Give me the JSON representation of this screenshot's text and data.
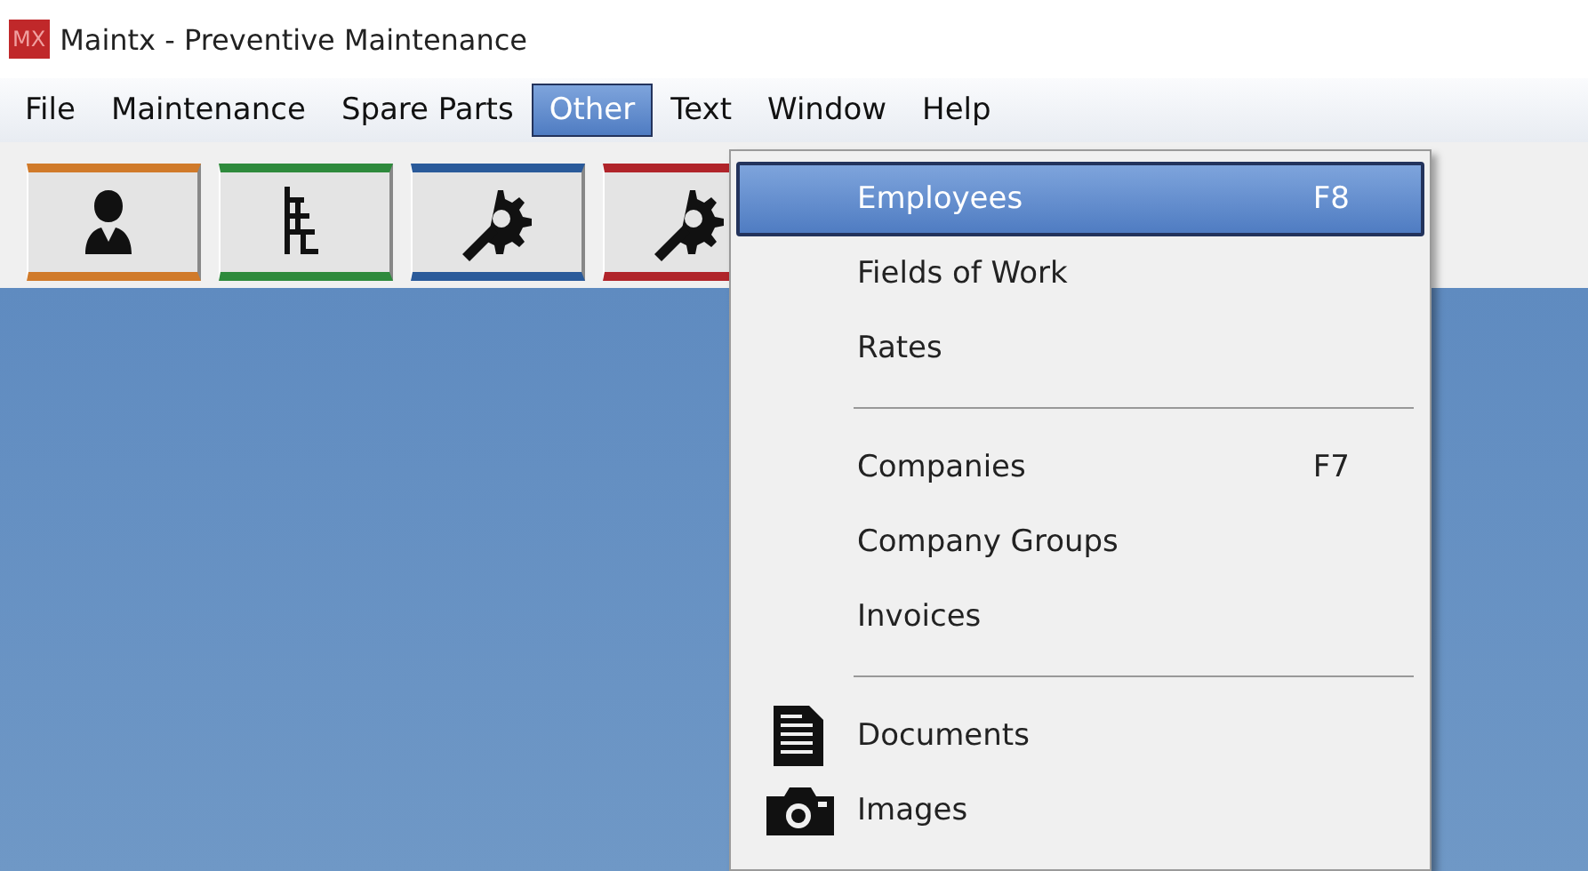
{
  "window": {
    "title": "Maintx - Preventive Maintenance",
    "logo": "MX"
  },
  "menubar": [
    {
      "label": "File",
      "selected": false
    },
    {
      "label": "Maintenance",
      "selected": false
    },
    {
      "label": "Spare Parts",
      "selected": false
    },
    {
      "label": "Other",
      "selected": true
    },
    {
      "label": "Text",
      "selected": false
    },
    {
      "label": "Window",
      "selected": false
    },
    {
      "label": "Help",
      "selected": false
    }
  ],
  "toolbar": [
    {
      "kind": "person",
      "color": "#d07a2a"
    },
    {
      "kind": "tree",
      "color": "#2e8a3c"
    },
    {
      "kind": "gear",
      "color": "#2a5a9a"
    },
    {
      "kind": "gear",
      "color": "#b0242a"
    }
  ],
  "menu": [
    {
      "kind": "plain",
      "label": "Employees",
      "shortcut": "F8",
      "selected": true
    },
    {
      "kind": "plain",
      "label": "Fields of Work",
      "selected": false
    },
    {
      "kind": "plain",
      "label": "Rates",
      "selected": false
    },
    {
      "kind": "separator"
    },
    {
      "kind": "plain",
      "label": "Companies",
      "shortcut": "F7",
      "selected": false
    },
    {
      "kind": "plain",
      "label": "Company Groups",
      "selected": false
    },
    {
      "kind": "plain",
      "label": "Invoices",
      "selected": false
    },
    {
      "kind": "separator"
    },
    {
      "kind": "document",
      "label": "Documents",
      "selected": false
    },
    {
      "kind": "camera",
      "label": "Images",
      "selected": false
    }
  ]
}
